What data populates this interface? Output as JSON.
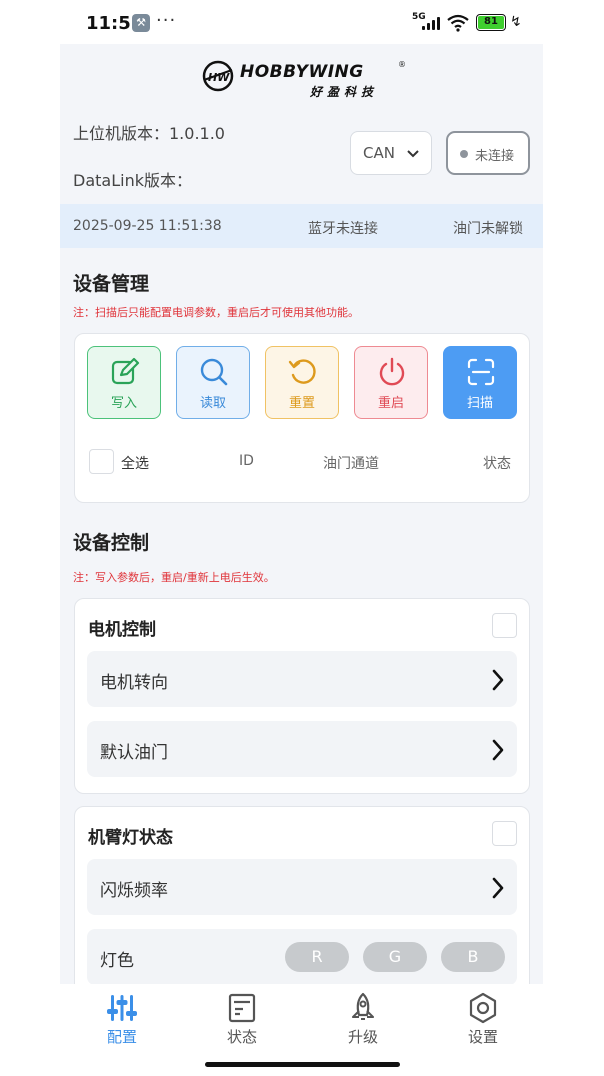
{
  "statusbar": {
    "time": "11:51",
    "dots": "···",
    "network": "5G",
    "battery": "81"
  },
  "brand": {
    "name": "HOBBYWING",
    "sub": "好盈科技",
    "mark": "HW",
    "reg": "®"
  },
  "header": {
    "host_version": "上位机版本：1.0.1.0",
    "datalink_version": "DataLink版本：",
    "protocol_select": "CAN",
    "connect_status": "未连接"
  },
  "info_bar": {
    "datetime": "2025-09-25 11:51:38",
    "bluetooth": "蓝牙未连接",
    "throttle": "油门未解锁"
  },
  "device_mgmt": {
    "title": "设备管理",
    "note": "注：扫描后只能配置电调参数，重启后才可使用其他功能。",
    "buttons": {
      "write": "写入",
      "read": "读取",
      "reset": "重置",
      "reboot": "重启",
      "scan": "扫描"
    },
    "table": {
      "select_all": "全选",
      "col_id": "ID",
      "col_channel": "油门通道",
      "col_status": "状态"
    }
  },
  "device_ctrl": {
    "title": "设备控制",
    "note": "注：写入参数后，重启/重新上电后生效。",
    "motor": {
      "title": "电机控制",
      "direction": "电机转向",
      "default_throttle": "默认油门"
    },
    "arm_light": {
      "title": "机臂灯状态",
      "blink_rate": "闪烁频率",
      "color": "灯色",
      "r": "R",
      "g": "G",
      "b": "B"
    }
  },
  "tabs": {
    "config": "配置",
    "status": "状态",
    "upgrade": "升级",
    "settings": "设置"
  },
  "colors": {
    "accent": "#3b8fe8",
    "warning": "#e0343a",
    "info_bar": "#e3eefb"
  }
}
